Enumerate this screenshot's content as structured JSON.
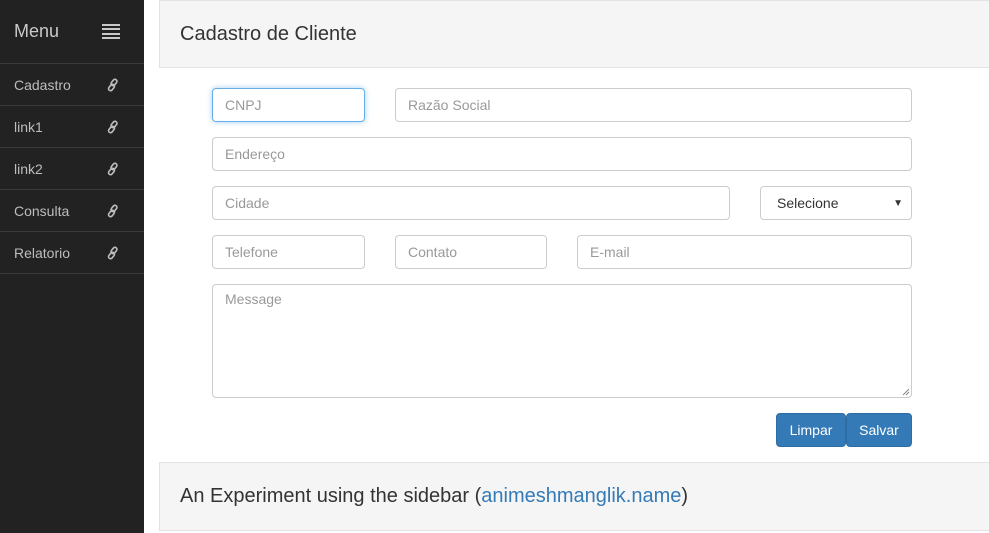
{
  "sidebar": {
    "title": "Menu",
    "items": [
      {
        "label": "Cadastro"
      },
      {
        "label": "link1"
      },
      {
        "label": "link2"
      },
      {
        "label": "Consulta"
      },
      {
        "label": "Relatorio"
      }
    ]
  },
  "form": {
    "heading": "Cadastro de Cliente",
    "cnpj": {
      "placeholder": "CNPJ",
      "value": ""
    },
    "razao_social": {
      "placeholder": "Razão Social",
      "value": ""
    },
    "endereco": {
      "placeholder": "Endereço",
      "value": ""
    },
    "cidade": {
      "placeholder": "Cidade",
      "value": ""
    },
    "estado_select": {
      "selected": "Selecione"
    },
    "telefone": {
      "placeholder": "Telefone",
      "value": ""
    },
    "contato": {
      "placeholder": "Contato",
      "value": ""
    },
    "email": {
      "placeholder": "E-mail",
      "value": ""
    },
    "message": {
      "placeholder": "Message",
      "value": ""
    },
    "buttons": {
      "clear_label": "Limpar",
      "save_label": "Salvar"
    }
  },
  "footer": {
    "text_before": "An Experiment using the sidebar (",
    "link_text": "animeshmanglik.name",
    "text_after": ")"
  },
  "colors": {
    "sidebar_bg": "#222222",
    "primary": "#337ab7",
    "panel_bg": "#f5f5f5"
  }
}
